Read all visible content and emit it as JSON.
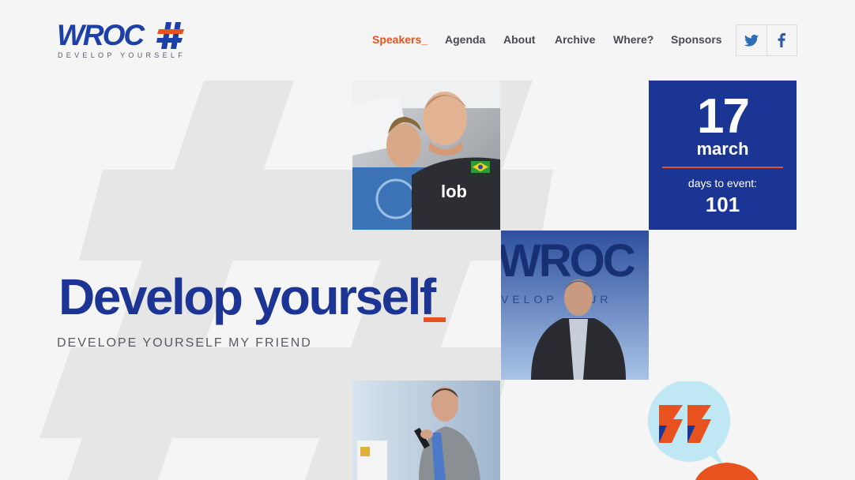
{
  "logo": {
    "word": "WROC",
    "tagline": "DEVELOP YOURSELF"
  },
  "nav": {
    "items": [
      {
        "label": "Speakers_",
        "active": true
      },
      {
        "label": "Agenda"
      },
      {
        "label": "About"
      },
      {
        "label": "Archive"
      },
      {
        "label": "Where?"
      },
      {
        "label": "Sponsors"
      }
    ]
  },
  "social": {
    "icons": [
      "twitter-icon",
      "facebook-icon"
    ]
  },
  "event": {
    "day": "17",
    "month": "march",
    "countdown_label": "days to event:",
    "countdown": "101"
  },
  "hero": {
    "title": "Develop yourself",
    "subtitle": "DEVELOPE YOURSELF MY FRIEND"
  },
  "photo_backdrop": {
    "word": "WROC",
    "tagline": "VELOP YOUR"
  },
  "colors": {
    "brand_blue": "#1c3594",
    "accent_orange": "#e8521f",
    "background": "#f5f5f5"
  }
}
